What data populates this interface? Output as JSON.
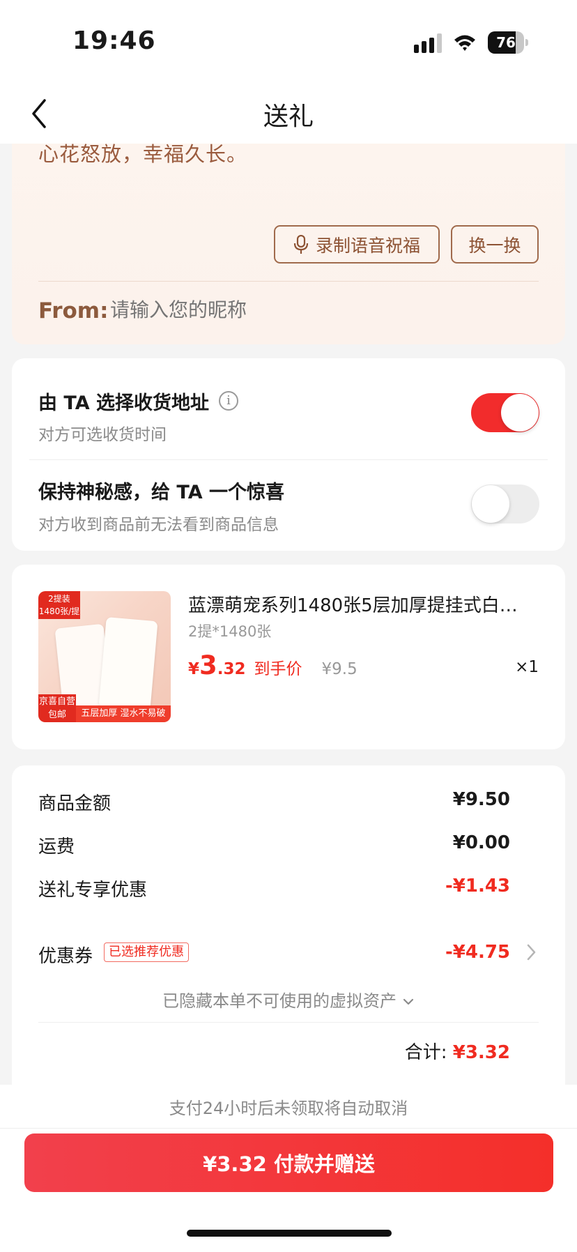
{
  "status_bar": {
    "time": "19:46",
    "battery": "76",
    "battery_level": 0.76
  },
  "nav": {
    "title": "送礼"
  },
  "message_card": {
    "message": "心花怒放，幸福久长。",
    "voice_button": "录制语音祝福",
    "swap_button": "换一换",
    "from_label": "From:",
    "nickname_placeholder": "请输入您的昵称"
  },
  "options": [
    {
      "title": "由 TA 选择收货地址",
      "subtitle": "对方可选收货时间",
      "enabled": true
    },
    {
      "title": "保持神秘感，给 TA 一个惊喜",
      "subtitle": "对方收到商品前无法看到商品信息",
      "enabled": false
    }
  ],
  "product": {
    "image_tags": {
      "pack": "2提装",
      "count": "1480张/提",
      "self_run": "京喜自营",
      "free_ship": "包邮",
      "feature": "五层加厚 湿水不易破"
    },
    "title": "蓝漂萌宠系列1480张5层加厚提挂式白…",
    "spec": "2提*1480张",
    "price_symbol": "¥",
    "price_int": "3",
    "price_dec": ".32",
    "price_tag": "到手价",
    "original_price": "¥9.5",
    "quantity": "×1"
  },
  "summary": {
    "items": [
      {
        "label": "商品金额",
        "value": "¥9.50"
      },
      {
        "label": "运费",
        "value": "¥0.00"
      },
      {
        "label": "送礼专享优惠",
        "value": "-¥1.43"
      },
      {
        "label": "优惠券",
        "value": "-¥4.75",
        "badge": "已选推荐优惠"
      }
    ],
    "hidden_assets": "已隐藏本单不可使用的虚拟资产",
    "total_label": "合计:",
    "total_value": "¥3.32"
  },
  "footer": {
    "auto_cancel": "支付24小时后未领取将自动取消",
    "pay_button": "¥3.32 付款并赠送"
  },
  "colors": {
    "accent_red": "#f02b20",
    "toggle_on": "#f22c2c",
    "brown": "#8d5334"
  }
}
